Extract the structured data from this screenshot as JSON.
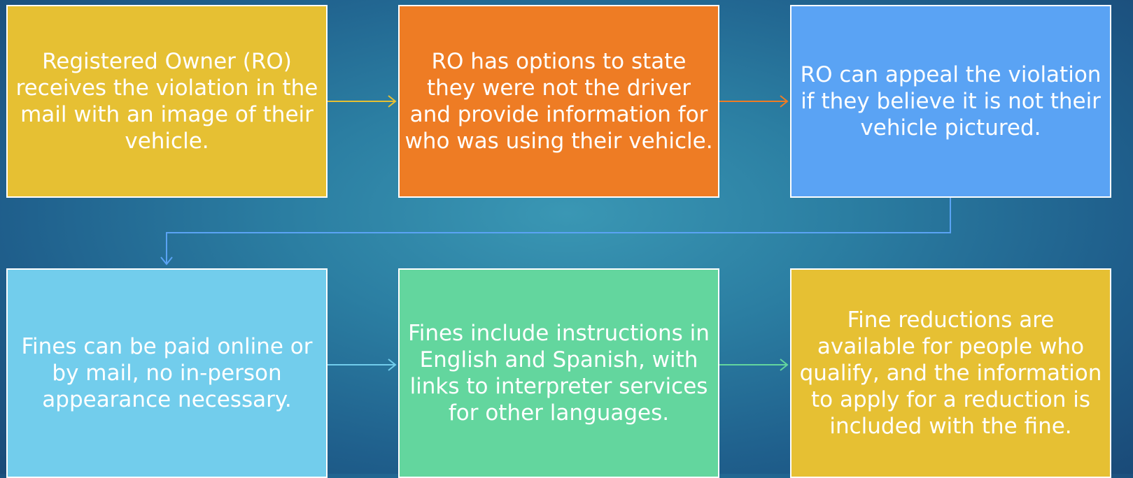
{
  "steps": [
    {
      "text": "Registered Owner (RO) receives the violation in the mail with an image of their vehicle.",
      "color": "#e6c033"
    },
    {
      "text": "RO has options to state they were not the driver and provide information for who was using their vehicle.",
      "color": "#ee7c24"
    },
    {
      "text": "RO can appeal the violation if they believe it is not their vehicle pictured.",
      "color": "#5aa3f4"
    },
    {
      "text": "Fines can be paid online or by mail, no in-person appearance necessary.",
      "color": "#72cdec"
    },
    {
      "text": "Fines include instructions in English and Spanish, with links to interpreter services for other languages.",
      "color": "#63d69e"
    },
    {
      "text": "Fine reductions are available for people who qualify, and the information to apply for a reduction is included with the fine.",
      "color": "#e6c033"
    }
  ],
  "connector_colors": {
    "step1_to_step2": "#e6c033",
    "step2_to_step3": "#ee7c24",
    "step3_to_step4": "#5aa3f4",
    "step4_to_step5": "#72cdec",
    "step5_to_step6": "#63d69e"
  }
}
